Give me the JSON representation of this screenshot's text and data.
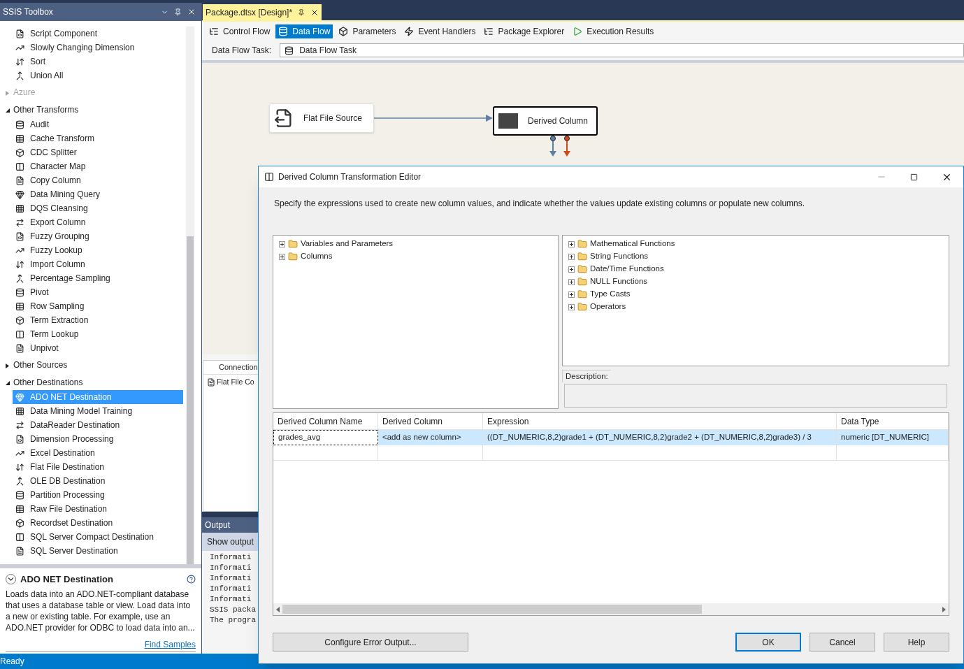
{
  "toolbox": {
    "title": "SSIS Toolbox",
    "entries": [
      {
        "kind": "tool",
        "label": "Script Component",
        "selected": false
      },
      {
        "kind": "tool",
        "label": "Slowly Changing Dimension",
        "selected": false
      },
      {
        "kind": "tool",
        "label": "Sort",
        "selected": false
      },
      {
        "kind": "tool",
        "label": "Union All",
        "selected": false
      },
      {
        "kind": "group",
        "label": "Azure",
        "expanded": false,
        "disabled": true
      },
      {
        "kind": "group",
        "label": "Other Transforms",
        "expanded": true,
        "disabled": false
      },
      {
        "kind": "tool",
        "label": "Audit",
        "selected": false
      },
      {
        "kind": "tool",
        "label": "Cache Transform",
        "selected": false
      },
      {
        "kind": "tool",
        "label": "CDC Splitter",
        "selected": false
      },
      {
        "kind": "tool",
        "label": "Character Map",
        "selected": false
      },
      {
        "kind": "tool",
        "label": "Copy Column",
        "selected": false
      },
      {
        "kind": "tool",
        "label": "Data Mining Query",
        "selected": false
      },
      {
        "kind": "tool",
        "label": "DQS Cleansing",
        "selected": false
      },
      {
        "kind": "tool",
        "label": "Export Column",
        "selected": false
      },
      {
        "kind": "tool",
        "label": "Fuzzy Grouping",
        "selected": false
      },
      {
        "kind": "tool",
        "label": "Fuzzy Lookup",
        "selected": false
      },
      {
        "kind": "tool",
        "label": "Import Column",
        "selected": false
      },
      {
        "kind": "tool",
        "label": "Percentage Sampling",
        "selected": false
      },
      {
        "kind": "tool",
        "label": "Pivot",
        "selected": false
      },
      {
        "kind": "tool",
        "label": "Row Sampling",
        "selected": false
      },
      {
        "kind": "tool",
        "label": "Term Extraction",
        "selected": false
      },
      {
        "kind": "tool",
        "label": "Term Lookup",
        "selected": false
      },
      {
        "kind": "tool",
        "label": "Unpivot",
        "selected": false
      },
      {
        "kind": "group",
        "label": "Other Sources",
        "expanded": false,
        "disabled": false
      },
      {
        "kind": "group",
        "label": "Other Destinations",
        "expanded": true,
        "disabled": false
      },
      {
        "kind": "tool",
        "label": "ADO NET Destination",
        "selected": true
      },
      {
        "kind": "tool",
        "label": "Data Mining Model Training",
        "selected": false
      },
      {
        "kind": "tool",
        "label": "DataReader Destination",
        "selected": false
      },
      {
        "kind": "tool",
        "label": "Dimension Processing",
        "selected": false
      },
      {
        "kind": "tool",
        "label": "Excel Destination",
        "selected": false
      },
      {
        "kind": "tool",
        "label": "Flat File Destination",
        "selected": false
      },
      {
        "kind": "tool",
        "label": "OLE DB Destination",
        "selected": false
      },
      {
        "kind": "tool",
        "label": "Partition Processing",
        "selected": false
      },
      {
        "kind": "tool",
        "label": "Raw File Destination",
        "selected": false
      },
      {
        "kind": "tool",
        "label": "Recordset Destination",
        "selected": false
      },
      {
        "kind": "tool",
        "label": "SQL Server Compact Destination",
        "selected": false
      },
      {
        "kind": "tool",
        "label": "SQL Server Destination",
        "selected": false
      }
    ],
    "description": {
      "title": "ADO NET Destination",
      "text": "Loads data into an ADO.NET-compliant database that uses a database table or view. Load data into a new or existing table. For example, use an ADO.NET provider for ODBC to load data into an...",
      "link": "Find Samples"
    }
  },
  "document_tab": {
    "title": "Package.dtsx [Design]*"
  },
  "designer_tabs": [
    {
      "label": "Control Flow",
      "selected": false
    },
    {
      "label": "Data Flow",
      "selected": true
    },
    {
      "label": "Parameters",
      "selected": false
    },
    {
      "label": "Event Handlers",
      "selected": false
    },
    {
      "label": "Package Explorer",
      "selected": false
    },
    {
      "label": "Execution Results",
      "selected": false
    }
  ],
  "data_flow_task": {
    "label": "Data Flow Task:",
    "value": "Data Flow Task"
  },
  "canvas_nodes": [
    {
      "label": "Flat File Source",
      "selected": false
    },
    {
      "label": "Derived Column",
      "selected": true
    }
  ],
  "connection_managers": {
    "header": "Connection",
    "items": [
      "Flat File Co"
    ]
  },
  "output": {
    "title": "Output",
    "show_output": "Show output",
    "lines": [
      "Informati",
      "Informati",
      "Informati",
      "Informati",
      "Informati",
      "SSIS packa",
      "The progra"
    ]
  },
  "dialog": {
    "title": "Derived Column Transformation Editor",
    "instructions": "Specify the expressions used to create new column values, and indicate whether the values update existing columns or populate new columns.",
    "left_tree": [
      {
        "label": "Variables and Parameters",
        "expanded": false
      },
      {
        "label": "Columns",
        "expanded": false
      }
    ],
    "right_tree": [
      {
        "label": "Mathematical Functions",
        "expanded": false
      },
      {
        "label": "String Functions",
        "expanded": false
      },
      {
        "label": "Date/Time Functions",
        "expanded": false
      },
      {
        "label": "NULL Functions",
        "expanded": false
      },
      {
        "label": "Type Casts",
        "expanded": false
      },
      {
        "label": "Operators",
        "expanded": false
      }
    ],
    "description_label": "Description:",
    "grid": {
      "columns": [
        "Derived Column Name",
        "Derived Column",
        "Expression",
        "Data Type"
      ],
      "rows": [
        {
          "cells": [
            "grades_avg",
            "<add as new column>",
            "((DT_NUMERIC,8,2)grade1 + (DT_NUMERIC,8,2)grade2 + (DT_NUMERIC,8,2)grade3) / 3",
            "numeric [DT_NUMERIC]"
          ],
          "selected": true
        }
      ]
    },
    "buttons": [
      "Configure Error Output...",
      "OK",
      "Cancel",
      "Help"
    ]
  },
  "status_bar": {
    "text": "Ready"
  }
}
